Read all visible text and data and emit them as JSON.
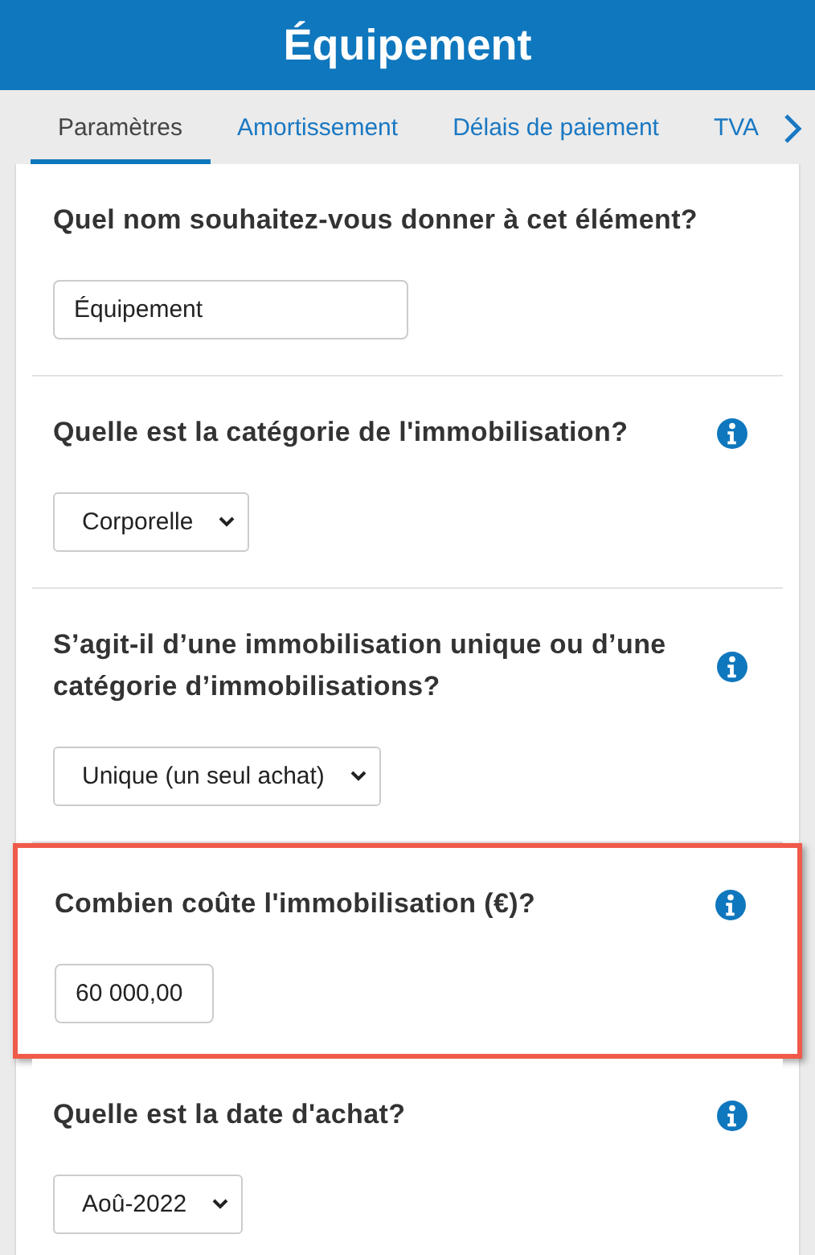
{
  "header": {
    "title": "Équipement"
  },
  "tabs": [
    {
      "label": "Paramètres",
      "selected": true
    },
    {
      "label": "Amortissement",
      "selected": false
    },
    {
      "label": "Délais de paiement",
      "selected": false
    },
    {
      "label": "TVA",
      "selected": false
    }
  ],
  "questions": [
    {
      "label": "Quel nom souhaitez-vous donner à cet élément?",
      "kind": "input",
      "value": "Équipement",
      "info": false,
      "highlighted": false
    },
    {
      "label": "Quelle est la catégorie de l'immobilisation?",
      "kind": "select",
      "value": "Corporelle",
      "info": true,
      "highlighted": false
    },
    {
      "label": "S’agit-il d’une immobilisation unique ou d’une catégorie d’immobilisations?",
      "kind": "select",
      "value": "Unique (un seul achat)",
      "info": true,
      "highlighted": false
    },
    {
      "label": "Combien coûte l'immobilisation (€)?",
      "kind": "input",
      "value": "60 000,00",
      "info": true,
      "highlighted": true
    },
    {
      "label": "Quelle est la date d'achat?",
      "kind": "select",
      "value": "Aoû-2022",
      "info": true,
      "highlighted": false
    }
  ]
}
